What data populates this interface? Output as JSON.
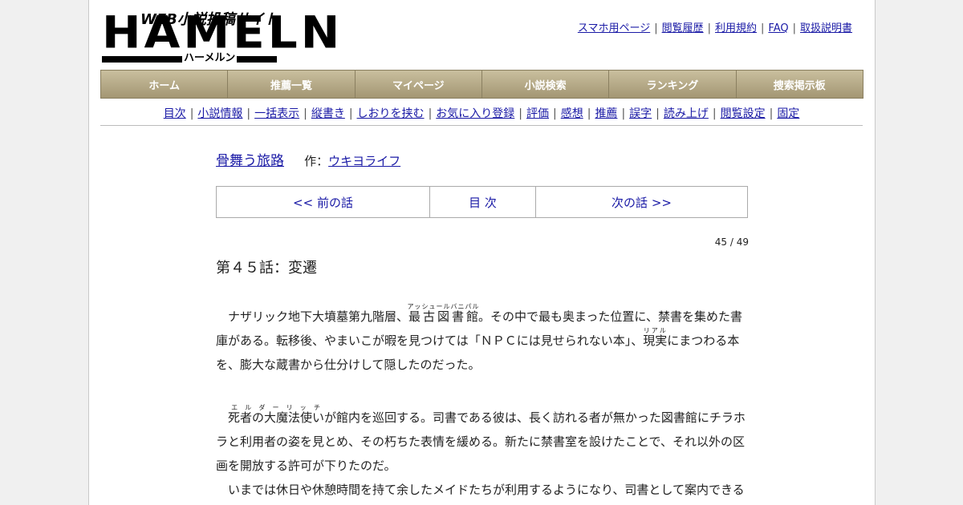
{
  "logo": {
    "tagline": "WEB小説投稿サイト",
    "word": "HAMELN",
    "kana": "ハーメルン"
  },
  "top_links": [
    "スマホ用ページ",
    "閲覧履歴",
    "利用規約",
    "FAQ",
    "取扱説明書"
  ],
  "main_nav": [
    "ホーム",
    "推薦一覧",
    "マイページ",
    "小説検索",
    "ランキング",
    "捜索掲示板"
  ],
  "sub_nav": [
    "目次",
    "小説情報",
    "一括表示",
    "縦書き",
    "しおりを挟む",
    "お気に入り登録",
    "評価",
    "感想",
    "推薦",
    "誤字",
    "読み上げ",
    "閲覧設定",
    "固定"
  ],
  "novel": {
    "title": "骨舞う旅路",
    "author_label": "作：",
    "author": "ウキヨライフ"
  },
  "pager": {
    "prev": "<< 前の話",
    "toc": "目 次",
    "next": "次の話 >>"
  },
  "counter": "45 / 49",
  "chapter_title": "第４５話：変遷",
  "body": {
    "p1_a": "　ナザリック地下大墳墓第九階層、",
    "p1_ruby1_base": "最古図書館",
    "p1_ruby1_text": "アッシュールバニパル",
    "p1_b": "。その中で最も奥まった位置に、禁書を集めた書庫がある。転移後、やまいこが暇を見つけては「ＮＰＣには見せられない本」、",
    "p1_ruby2_base": "現実",
    "p1_ruby2_text": "リアル",
    "p1_c": "にまつわる本を、膨大な蔵書から仕分けして隠したのだった。",
    "p2_a": "　",
    "p2_ruby_base": "死者の大魔法使い",
    "p2_ruby_text": "エルダーリッチ",
    "p2_b": "が館内を巡回する。司書である彼は、長く訪れる者が無かった図書館にチラホラと利用者の姿を見とめ、その朽ちた表情を緩める。新たに禁書室を設けたことで、それ以外の区画を開放する許可が下りたのだ。",
    "p3": "　いまでは休日や休憩時間を持て余したメイドたちが利用するようになり、司書として案内できる"
  }
}
